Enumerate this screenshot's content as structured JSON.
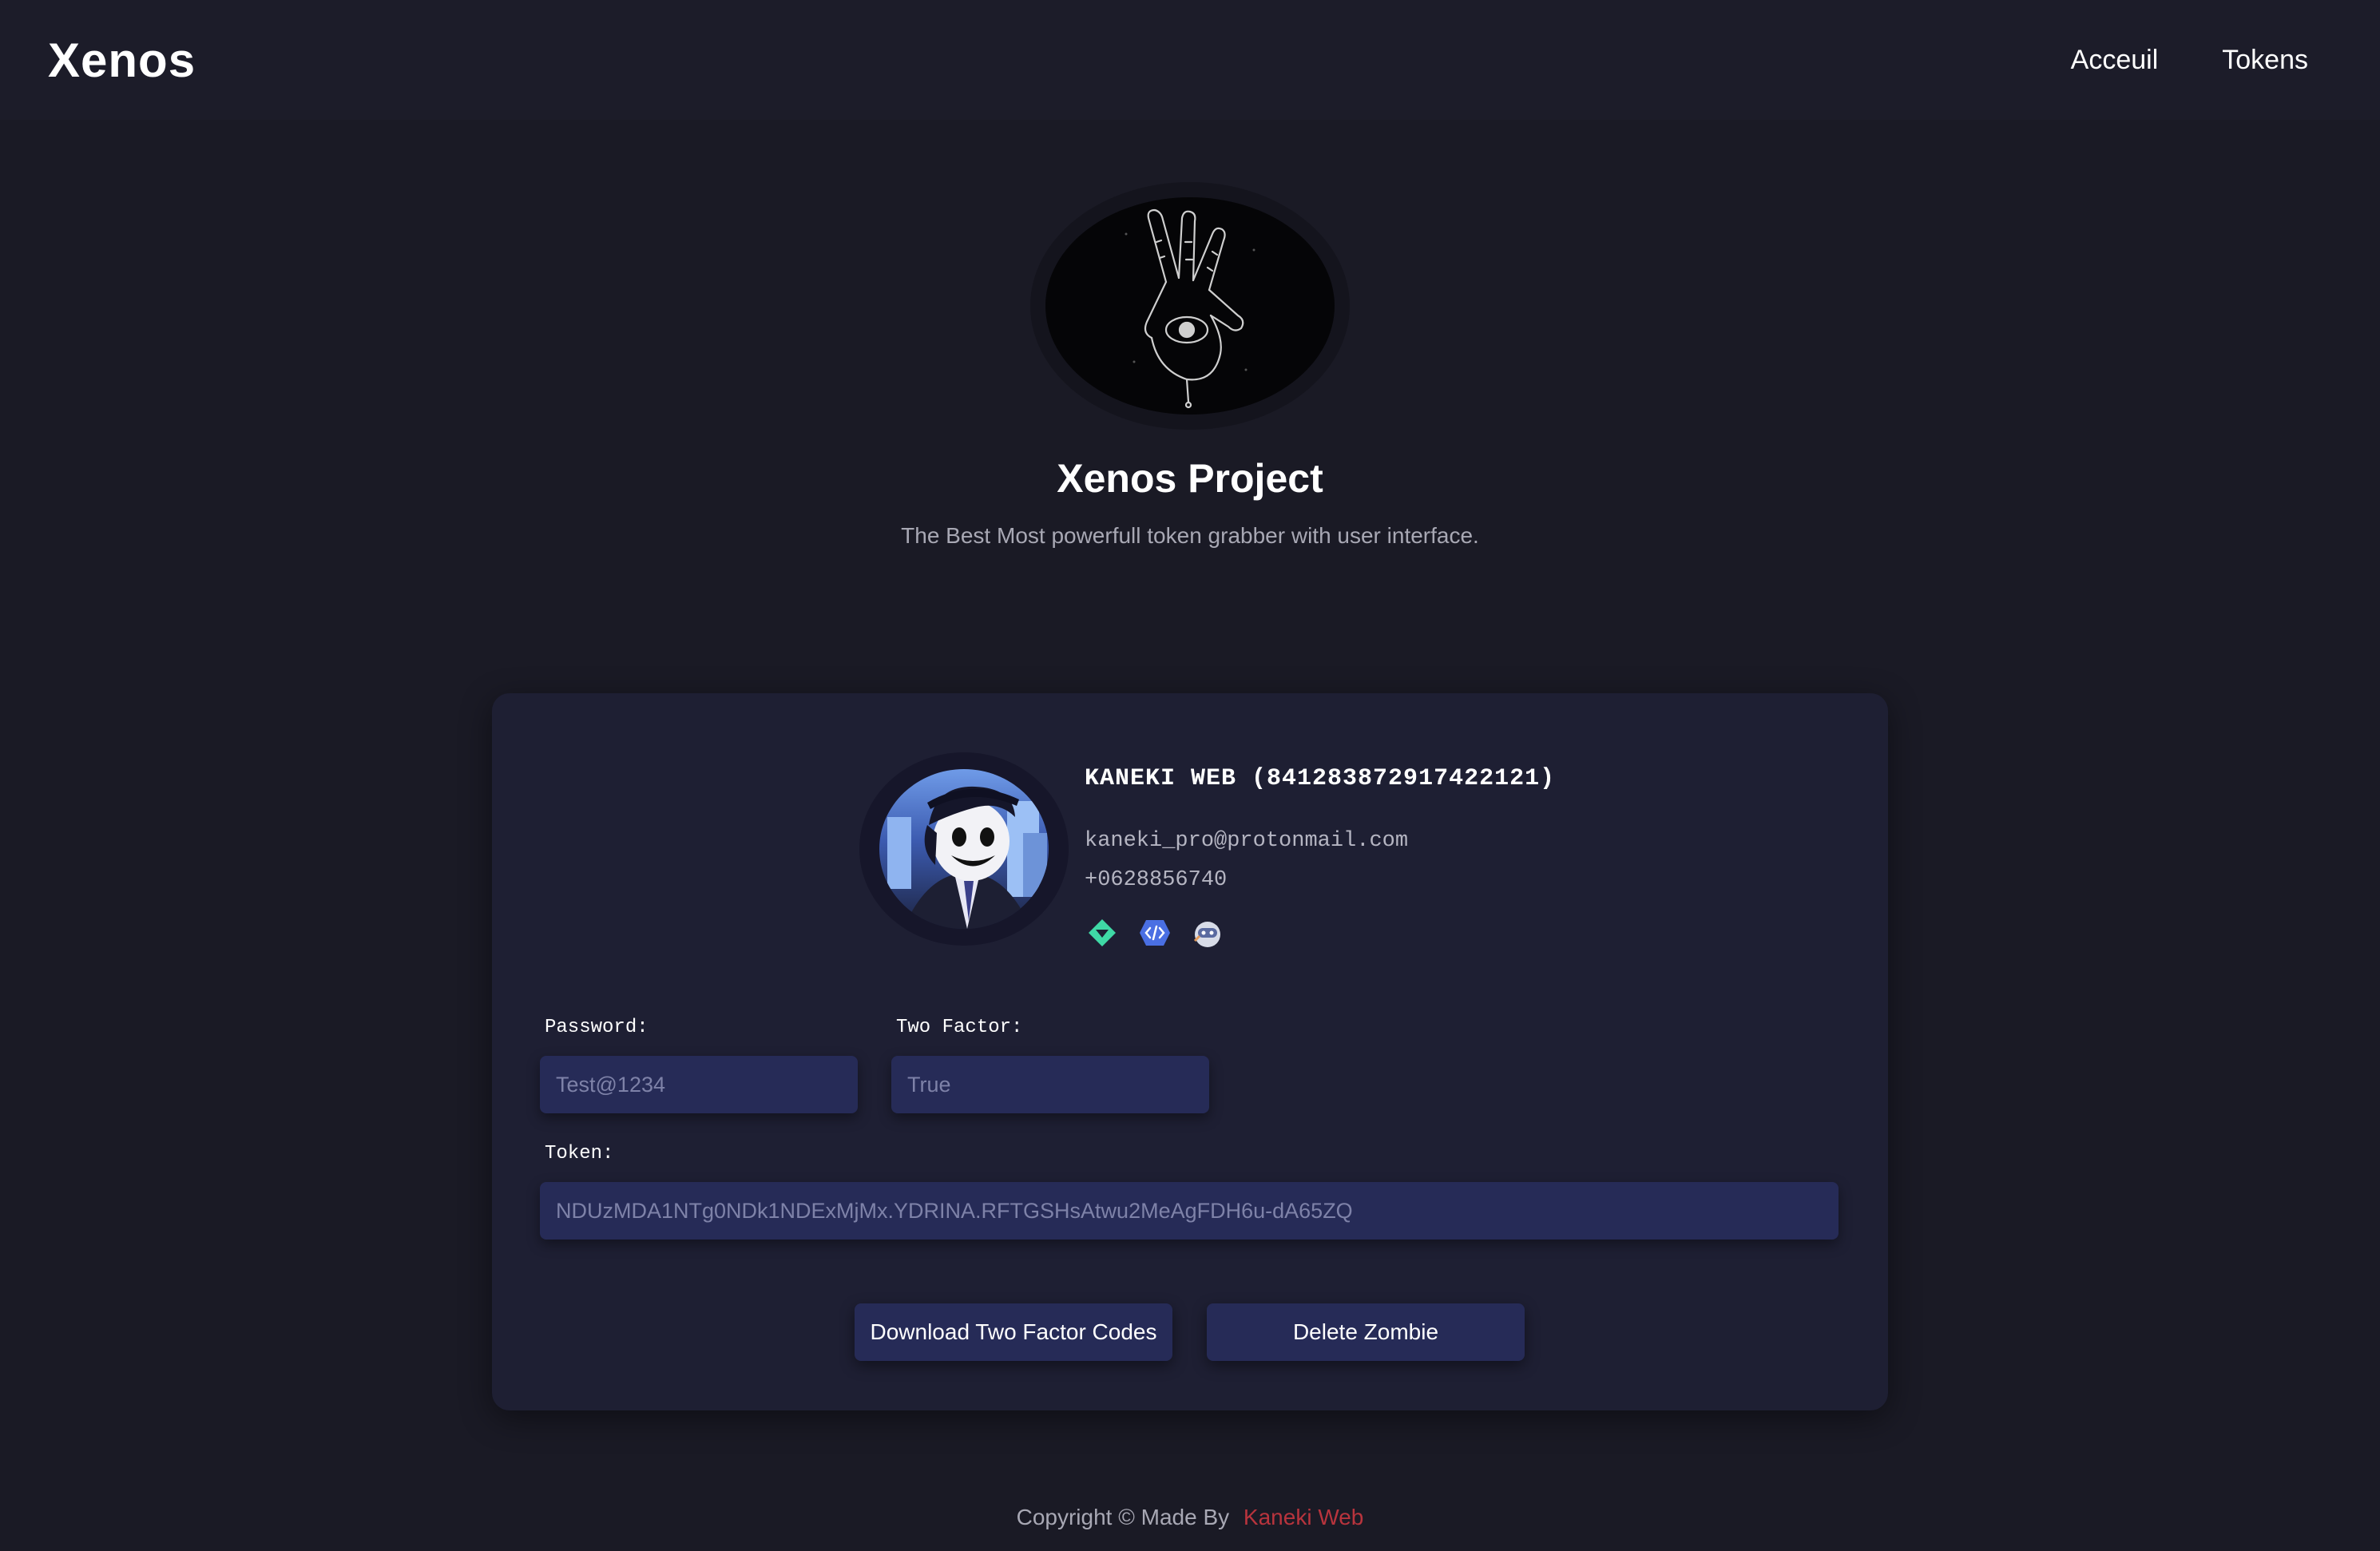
{
  "header": {
    "brand": "Xenos",
    "nav": [
      {
        "label": "Acceuil"
      },
      {
        "label": "Tokens"
      }
    ]
  },
  "hero": {
    "logo_icon": "hand-eye-icon",
    "title": "Xenos Project",
    "subtitle": "The Best Most powerfull token grabber with user interface."
  },
  "profile": {
    "avatar_icon": "anime-avatar",
    "name": "KANEKI WEB (841283872917422121)",
    "email": "kaneki_pro@protonmail.com",
    "phone": "+0628856740",
    "badges": [
      {
        "icon": "hypesquad-balance-icon",
        "color": "#3fd9a6"
      },
      {
        "icon": "active-developer-icon",
        "color": "#4a6fe3"
      },
      {
        "icon": "bot-avatar-icon",
        "color": "#d8dce8"
      }
    ]
  },
  "fields": {
    "password_label": "Password:",
    "password_value": "Test@1234",
    "two_factor_label": "Two Factor:",
    "two_factor_value": "True",
    "token_label": "Token:",
    "token_value": "NDUzMDA1NTg0NDk1NDExMjMx.YDRINA.RFTGSHsAtwu2MeAgFDH6u-dA65ZQ"
  },
  "actions": {
    "download_label": "Download Two Factor Codes",
    "delete_label": "Delete Zombie"
  },
  "footer": {
    "text": "Copyright © Made By",
    "author": "Kaneki Web"
  },
  "colors": {
    "background": "#1a1a25",
    "card": "#1e1f33",
    "input": "#262b57",
    "footer_link": "#b8343d"
  }
}
